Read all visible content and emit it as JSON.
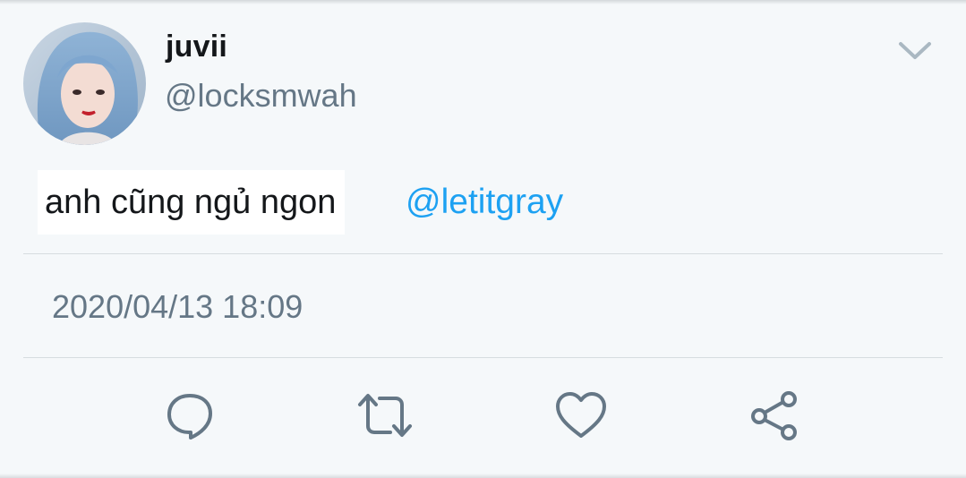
{
  "user": {
    "display_name": "juvii",
    "handle": "@locksmwah"
  },
  "tweet": {
    "text": "anh cũng ngủ ngon",
    "mention": "@letitgray",
    "timestamp": "2020/04/13 18:09"
  },
  "icons": {
    "menu": "chevron-down-icon",
    "reply": "reply-icon",
    "retweet": "retweet-icon",
    "like": "heart-icon",
    "share": "share-icon"
  },
  "colors": {
    "background": "#f5f8fa",
    "name": "#14171a",
    "secondary": "#657786",
    "link": "#1da1f2",
    "icon": "#657786",
    "divider": "#d6dce0"
  }
}
